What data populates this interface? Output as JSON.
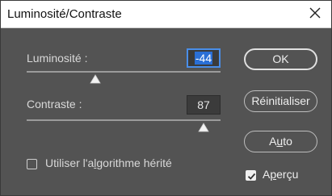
{
  "dialog": {
    "title": "Luminosité/Contraste",
    "close_glyph": "×"
  },
  "brightness": {
    "label": "Luminosité :",
    "value": "-44",
    "slider_value": -44,
    "slider_range": [
      -150,
      150
    ]
  },
  "contrast": {
    "label": "Contraste :",
    "value": "87",
    "slider_value": 87,
    "slider_range": [
      -50,
      100
    ]
  },
  "legacy": {
    "label_before": "Utiliser l'a",
    "label_mnemonic": "l",
    "label_after": "gorithme hérité",
    "checked": false
  },
  "buttons": {
    "ok": "OK",
    "reset": "Réinitialiser",
    "auto_before": "A",
    "auto_mnemonic": "u",
    "auto_after": "to"
  },
  "preview": {
    "label_before": "A",
    "label_mnemonic": "p",
    "label_after": "erçu",
    "checked": true
  },
  "icons": {
    "close": "close-icon",
    "thumb": "triangle-up-icon",
    "check": "checkmark-icon"
  },
  "colors": {
    "background": "#535353",
    "titlebar": "#ffffff",
    "focus": "#4a8ee8"
  }
}
